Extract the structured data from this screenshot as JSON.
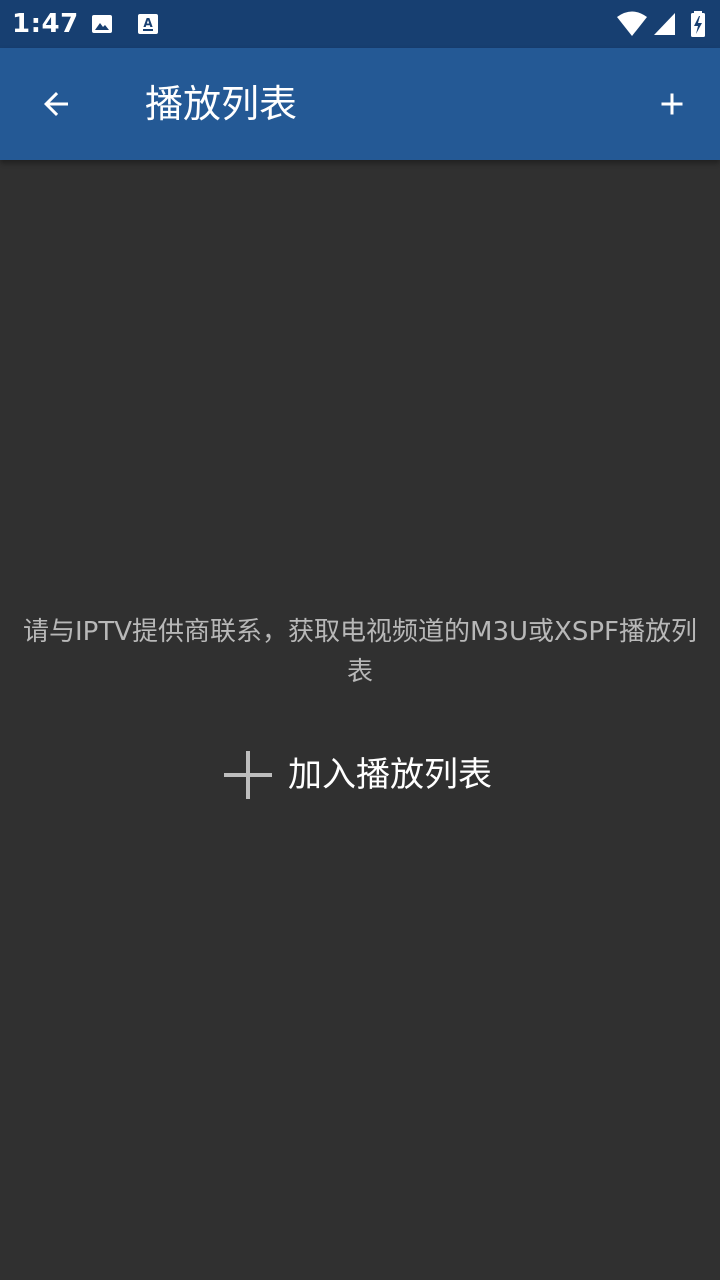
{
  "status_bar": {
    "time": "1:47",
    "icons": [
      "image-icon",
      "accessibility-a-icon",
      "wifi-icon",
      "signal-icon",
      "battery-charging-icon"
    ]
  },
  "app_bar": {
    "back_icon": "arrow-left-icon",
    "title": "播放列表",
    "add_icon": "plus-icon",
    "background_color": "#245995",
    "status_color": "#173f71"
  },
  "empty_state": {
    "message": "请与IPTV提供商联系，获取电视频道的M3U或XSPF播放列表",
    "add_button_label": "加入播放列表",
    "add_button_icon": "plus-icon"
  },
  "colors": {
    "background": "#303030",
    "hint_text": "#b8b8b8"
  }
}
